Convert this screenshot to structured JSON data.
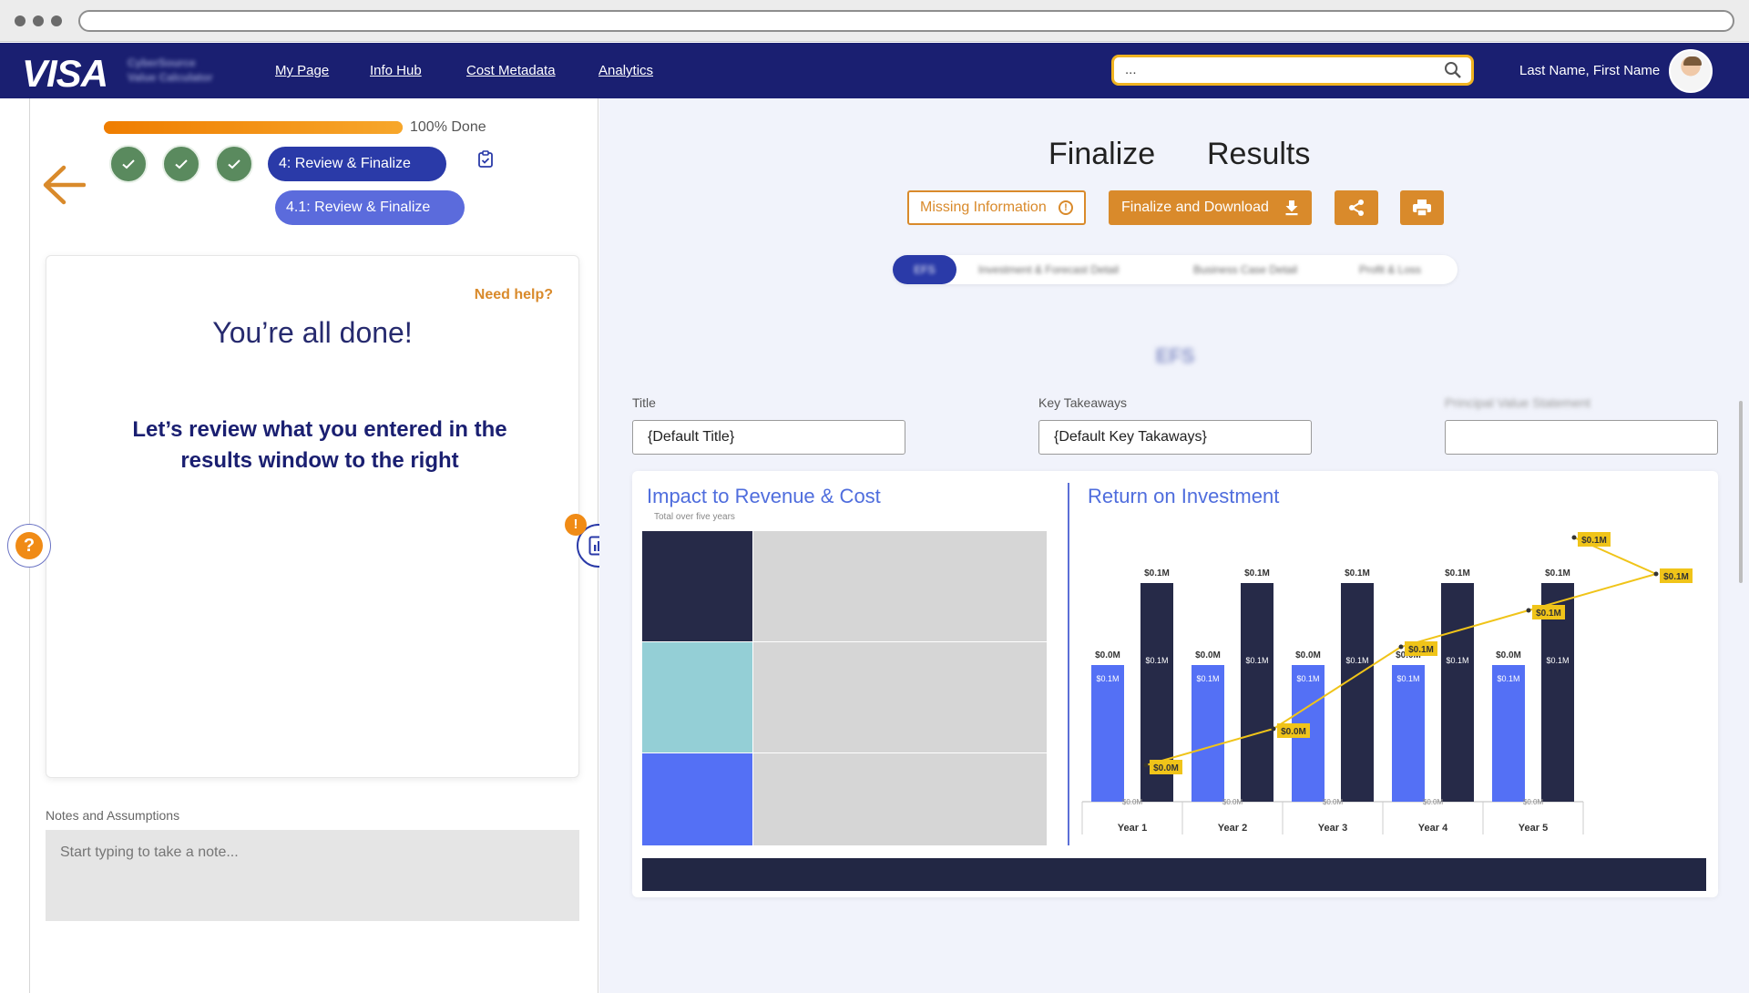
{
  "navbar": {
    "logo": "VISA",
    "brand_subtitle": [
      "CyberSource",
      "Value Calculator"
    ],
    "links": [
      "My Page",
      "Info Hub",
      "Cost Metadata",
      "Analytics"
    ],
    "search_value": "...",
    "user_name": "Last Name, First Name",
    "bg_color": "#1a1f71"
  },
  "wizard": {
    "progress_percent": 100,
    "progress_label": "100% Done",
    "completed_steps": 3,
    "current_step": "4: Review & Finalize",
    "current_substep": "4.1: Review & Finalize"
  },
  "done_card": {
    "help_link": "Need help?",
    "title": "You’re all done!",
    "message": "Let’s review what you entered in the results window to the right"
  },
  "side_controls": {
    "help_glyph": "?",
    "alert_glyph": "!"
  },
  "notes": {
    "label": "Notes and Assumptions",
    "placeholder": "Start typing to take a note..."
  },
  "results": {
    "tabs": [
      "Finalize",
      "Results"
    ],
    "missing_info_label": "Missing Information",
    "finalize_label": "Finalize and Download",
    "sub_tabs": [
      "EFS",
      "Investment & Forecast Detail",
      "Business Case Detail",
      "Profit & Loss"
    ],
    "section_heading": "EFS",
    "fields": [
      {
        "label": "Title",
        "value": "{Default Title}"
      },
      {
        "label": "Key Takeaways",
        "value": "{Default Key Takaways}"
      },
      {
        "label": "Principal Value Statement",
        "value": ""
      }
    ]
  },
  "impact_chart": {
    "title": "Impact to Revenue & Cost",
    "subtitle": "Total over five years"
  },
  "chart_data": {
    "type": "bar",
    "title": "Return on Investment",
    "categories": [
      "Year 1",
      "Year 2",
      "Year 3",
      "Year 4",
      "Year 5"
    ],
    "series": [
      {
        "values": [
          0.0,
          0.0,
          0.0,
          0.0,
          0.0
        ],
        "value_labels": [
          "$0.0M",
          "$0.0M",
          "$0.0M",
          "$0.0M",
          "$0.0M"
        ],
        "inner_labels": [
          "$0.1M",
          "$0.1M",
          "$0.1M",
          "$0.1M",
          "$0.1M"
        ],
        "color": "#5470f5"
      },
      {
        "values": [
          0.1,
          0.1,
          0.1,
          0.1,
          0.1
        ],
        "value_labels": [
          "$0.1M",
          "$0.1M",
          "$0.1M",
          "$0.1M",
          "$0.1M"
        ],
        "inner_labels": [
          "$0.1M",
          "$0.1M",
          "$0.1M",
          "$0.1M",
          "$0.1M"
        ],
        "color": "#262a48"
      }
    ],
    "line": {
      "values": [
        0.0,
        0.0,
        0.1,
        0.1,
        0.1
      ],
      "labels": [
        "$0.0M",
        "$0.0M",
        "$0.1M",
        "$0.1M",
        "$0.1M"
      ],
      "color": "#f0c419"
    },
    "bottom_labels": [
      "$0.0M",
      "$0.0M",
      "$0.0M",
      "$0.0M",
      "$0.0M"
    ]
  },
  "colors": {
    "accent_orange": "#d98a2b",
    "primary_blue": "#2a3aa8",
    "check_green": "#5a8a5e",
    "treemap": [
      "#262a48",
      "#94cfd6",
      "#5470f5",
      "#d6d6d6"
    ]
  }
}
